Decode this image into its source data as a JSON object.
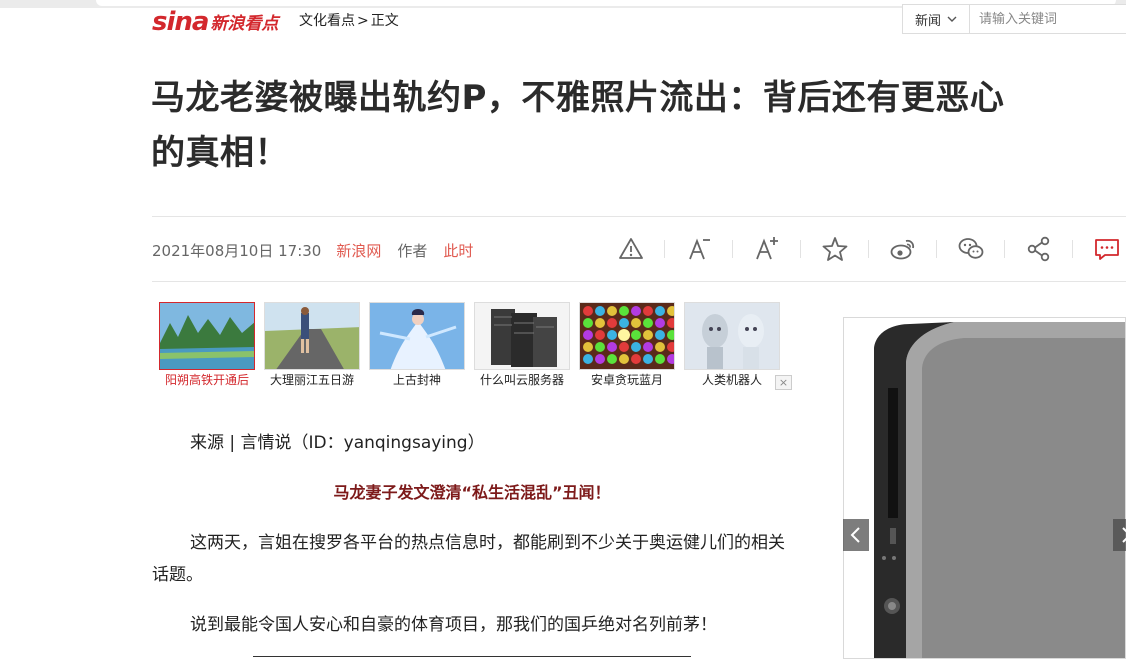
{
  "header": {
    "logo_text": "sina",
    "logo_sub": "新浪看点",
    "breadcrumb": [
      "文化看点",
      ">",
      "正文"
    ]
  },
  "search": {
    "category": "新闻",
    "placeholder": "请输入关键词"
  },
  "article": {
    "title_line1": "马龙老婆被曝出轨约P，不雅照片流出：背后还有更恶心",
    "title_line2": "的真相！",
    "datetime": "2021年08月10日 17:30",
    "source": "新浪网",
    "author_label": "作者",
    "author": "此时",
    "para_source": "来源 | 言情说（ID：yanqingsaying）",
    "subheading": "马龙妻子发文澄清“私生活混乱”丑闻！",
    "para1": "这两天，言姐在搜罗各平台的热点信息时，都能刷到不少关于奥运健儿们的相关话题。",
    "para2": "说到最能令国人安心和自豪的体育项目，那我们的国乒绝对名列前茅！"
  },
  "toolbar": {
    "icons": [
      "report-icon",
      "font-smaller-icon",
      "font-larger-icon",
      "favorite-star-icon",
      "weibo-icon",
      "wechat-icon",
      "share-icon",
      "comment-icon"
    ]
  },
  "thumbnails": [
    {
      "caption": "阳朔高铁开通后",
      "icon": "landscape-photo"
    },
    {
      "caption": "大理丽江五日游",
      "icon": "road-trip-photo"
    },
    {
      "caption": "上古封神",
      "icon": "game-character-photo"
    },
    {
      "caption": "什么叫云服务器",
      "icon": "server-rack-photo"
    },
    {
      "caption": "安卓贪玩蓝月",
      "icon": "gem-puzzle-photo"
    },
    {
      "caption": "人类机器人",
      "icon": "robot-faces-photo"
    }
  ],
  "colors": {
    "brand_red": "#d3282d",
    "link_red": "#e05a50",
    "subheading": "#7d1a1a"
  }
}
